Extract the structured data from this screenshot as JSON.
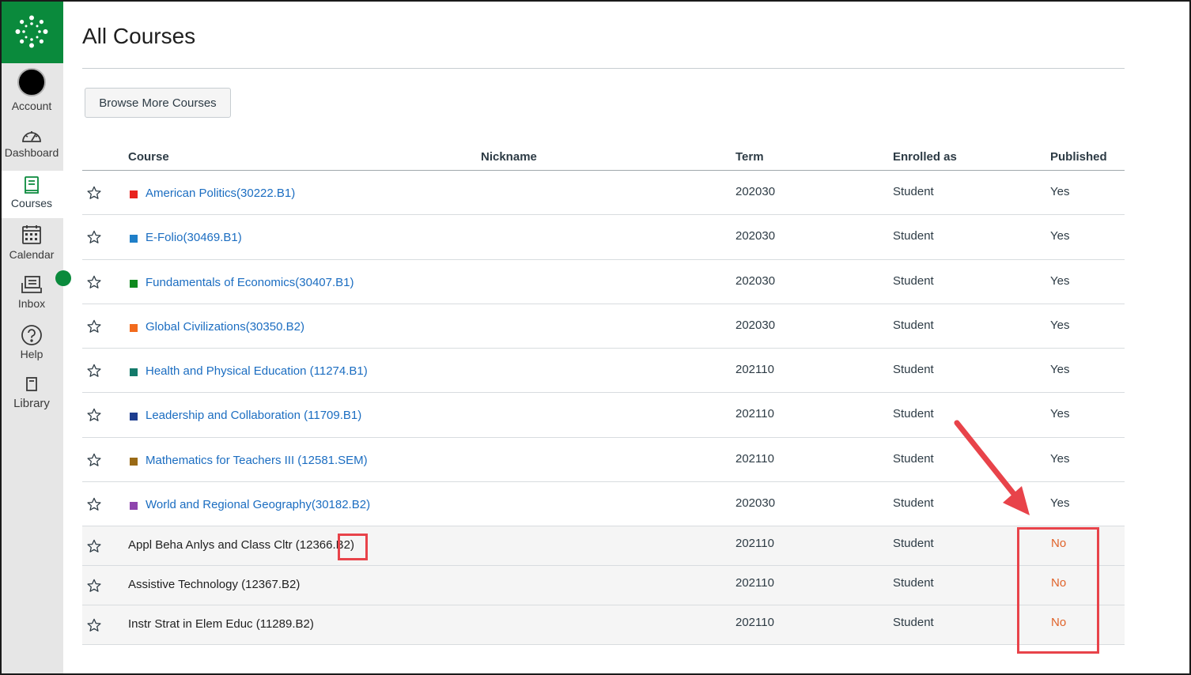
{
  "nav": {
    "items": [
      {
        "label": "Account",
        "icon": "avatar"
      },
      {
        "label": "Dashboard",
        "icon": "dashboard-icon"
      },
      {
        "label": "Courses",
        "icon": "courses-icon",
        "active": true
      },
      {
        "label": "Calendar",
        "icon": "calendar-icon"
      },
      {
        "label": "Inbox",
        "icon": "inbox-icon"
      },
      {
        "label": "Help",
        "icon": "help-icon"
      },
      {
        "label": "Library",
        "icon": "library-icon"
      }
    ]
  },
  "page": {
    "title": "All Courses",
    "browse_button": "Browse More Courses"
  },
  "table": {
    "headers": {
      "course": "Course",
      "nickname": "Nickname",
      "term": "Term",
      "enrolled": "Enrolled as",
      "published": "Published"
    },
    "rows": [
      {
        "course": "American Politics(30222.B1)",
        "term": "202030",
        "enrolled": "Student",
        "published": "Yes",
        "color": "#e8231e"
      },
      {
        "course": "E-Folio(30469.B1)",
        "term": "202030",
        "enrolled": "Student",
        "published": "Yes",
        "color": "#1f7fc8"
      },
      {
        "course": "Fundamentals of Economics(30407.B1)",
        "term": "202030",
        "enrolled": "Student",
        "published": "Yes",
        "color": "#0f8a1e"
      },
      {
        "course": "Global Civilizations(30350.B2)",
        "term": "202030",
        "enrolled": "Student",
        "published": "Yes",
        "color": "#f26b1d"
      },
      {
        "course": "Health and Physical Education (11274.B1)",
        "term": "202110",
        "enrolled": "Student",
        "published": "Yes",
        "color": "#137a6a"
      },
      {
        "course": "Leadership and Collaboration (11709.B1)",
        "term": "202110",
        "enrolled": "Student",
        "published": "Yes",
        "color": "#1d3d8f"
      },
      {
        "course": "Mathematics for Teachers III (12581.SEM)",
        "term": "202110",
        "enrolled": "Student",
        "published": "Yes",
        "color": "#9a6a16"
      },
      {
        "course": "World and Regional Geography(30182.B2)",
        "term": "202030",
        "enrolled": "Student",
        "published": "Yes",
        "color": "#8e44ad"
      },
      {
        "course": "Appl Beha Anlys and Class Cltr (12366.B2)",
        "term": "202110",
        "enrolled": "Student",
        "published": "No"
      },
      {
        "course": "Assistive Technology (12367.B2)",
        "term": "202110",
        "enrolled": "Student",
        "published": "No"
      },
      {
        "course": "Instr Strat in Elem Educ (11289.B2)",
        "term": "202110",
        "enrolled": "Student",
        "published": "No"
      }
    ]
  },
  "colors": {
    "brand": "#0a8a3c",
    "link": "#1b6dc1",
    "unpublished": "#e0632a",
    "annotation": "#e8434a"
  }
}
